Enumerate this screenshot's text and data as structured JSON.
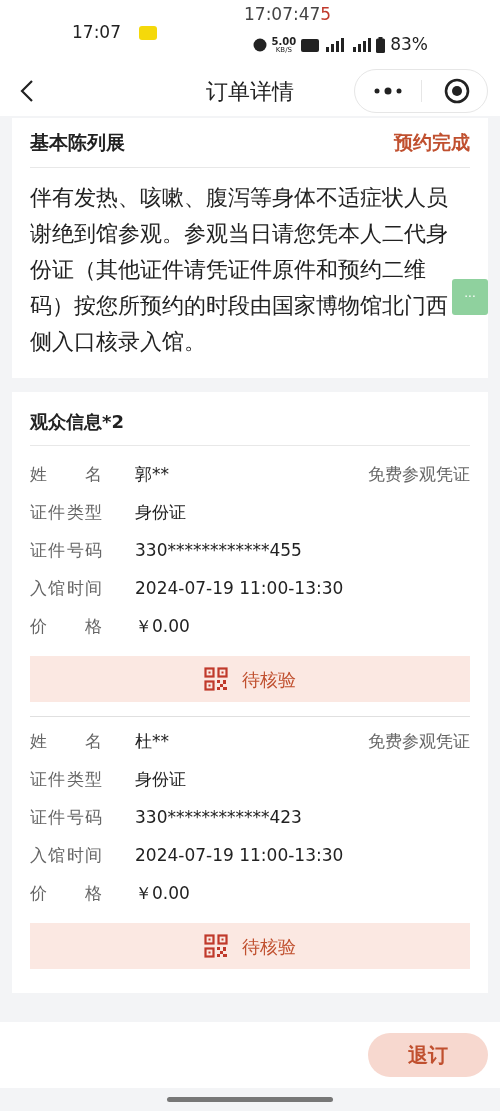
{
  "status_bar": {
    "time": "17:07",
    "overlay_time": "17:07:47",
    "overlay_digit": "5",
    "speed": "5.00",
    "speed_unit": "KB/S",
    "battery": "83%"
  },
  "header": {
    "title": "订单详情"
  },
  "exhibition": {
    "title": "基本陈列展",
    "status": "预约完成",
    "notice": "伴有发热、咳嗽、腹泻等身体不适症状人员谢绝到馆参观。参观当日请您凭本人二代身份证（其他证件请凭证件原件和预约二维码）按您所预约的时段由国家博物馆北门西侧入口核录入馆。"
  },
  "visitors": {
    "title": "观众信息*2",
    "people": [
      {
        "ticket_type": "免费参观凭证",
        "fields": [
          {
            "label": "姓名",
            "value": "郭**"
          },
          {
            "label": "证件类型",
            "value": "身份证"
          },
          {
            "label": "证件号码",
            "value": "330************455"
          },
          {
            "label": "入馆时间",
            "value": "2024-07-19 11:00-13:30"
          },
          {
            "label": "价格",
            "value": "￥0.00"
          }
        ],
        "verify_button": "待核验"
      },
      {
        "ticket_type": "免费参观凭证",
        "fields": [
          {
            "label": "姓名",
            "value": "杜**"
          },
          {
            "label": "证件类型",
            "value": "身份证"
          },
          {
            "label": "证件号码",
            "value": "330************423"
          },
          {
            "label": "入馆时间",
            "value": "2024-07-19 11:00-13:30"
          },
          {
            "label": "价格",
            "value": "￥0.00"
          }
        ],
        "verify_button": "待核验"
      }
    ]
  },
  "floating_button": {
    "label": "···"
  },
  "footer": {
    "cancel_button": "退订"
  }
}
